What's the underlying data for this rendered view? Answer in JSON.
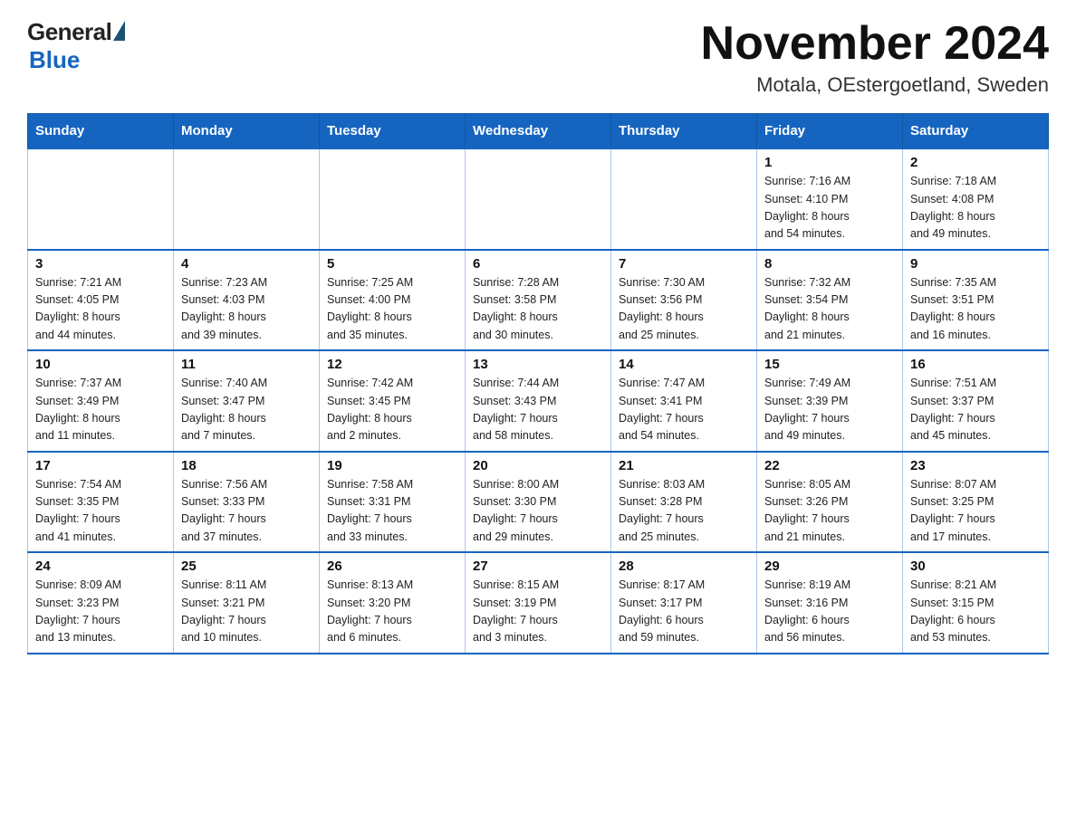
{
  "header": {
    "logo_general": "General",
    "logo_blue": "Blue",
    "month_title": "November 2024",
    "location": "Motala, OEstergoetland, Sweden"
  },
  "calendar": {
    "days_of_week": [
      "Sunday",
      "Monday",
      "Tuesday",
      "Wednesday",
      "Thursday",
      "Friday",
      "Saturday"
    ],
    "weeks": [
      [
        {
          "day": "",
          "info": ""
        },
        {
          "day": "",
          "info": ""
        },
        {
          "day": "",
          "info": ""
        },
        {
          "day": "",
          "info": ""
        },
        {
          "day": "",
          "info": ""
        },
        {
          "day": "1",
          "info": "Sunrise: 7:16 AM\nSunset: 4:10 PM\nDaylight: 8 hours\nand 54 minutes."
        },
        {
          "day": "2",
          "info": "Sunrise: 7:18 AM\nSunset: 4:08 PM\nDaylight: 8 hours\nand 49 minutes."
        }
      ],
      [
        {
          "day": "3",
          "info": "Sunrise: 7:21 AM\nSunset: 4:05 PM\nDaylight: 8 hours\nand 44 minutes."
        },
        {
          "day": "4",
          "info": "Sunrise: 7:23 AM\nSunset: 4:03 PM\nDaylight: 8 hours\nand 39 minutes."
        },
        {
          "day": "5",
          "info": "Sunrise: 7:25 AM\nSunset: 4:00 PM\nDaylight: 8 hours\nand 35 minutes."
        },
        {
          "day": "6",
          "info": "Sunrise: 7:28 AM\nSunset: 3:58 PM\nDaylight: 8 hours\nand 30 minutes."
        },
        {
          "day": "7",
          "info": "Sunrise: 7:30 AM\nSunset: 3:56 PM\nDaylight: 8 hours\nand 25 minutes."
        },
        {
          "day": "8",
          "info": "Sunrise: 7:32 AM\nSunset: 3:54 PM\nDaylight: 8 hours\nand 21 minutes."
        },
        {
          "day": "9",
          "info": "Sunrise: 7:35 AM\nSunset: 3:51 PM\nDaylight: 8 hours\nand 16 minutes."
        }
      ],
      [
        {
          "day": "10",
          "info": "Sunrise: 7:37 AM\nSunset: 3:49 PM\nDaylight: 8 hours\nand 11 minutes."
        },
        {
          "day": "11",
          "info": "Sunrise: 7:40 AM\nSunset: 3:47 PM\nDaylight: 8 hours\nand 7 minutes."
        },
        {
          "day": "12",
          "info": "Sunrise: 7:42 AM\nSunset: 3:45 PM\nDaylight: 8 hours\nand 2 minutes."
        },
        {
          "day": "13",
          "info": "Sunrise: 7:44 AM\nSunset: 3:43 PM\nDaylight: 7 hours\nand 58 minutes."
        },
        {
          "day": "14",
          "info": "Sunrise: 7:47 AM\nSunset: 3:41 PM\nDaylight: 7 hours\nand 54 minutes."
        },
        {
          "day": "15",
          "info": "Sunrise: 7:49 AM\nSunset: 3:39 PM\nDaylight: 7 hours\nand 49 minutes."
        },
        {
          "day": "16",
          "info": "Sunrise: 7:51 AM\nSunset: 3:37 PM\nDaylight: 7 hours\nand 45 minutes."
        }
      ],
      [
        {
          "day": "17",
          "info": "Sunrise: 7:54 AM\nSunset: 3:35 PM\nDaylight: 7 hours\nand 41 minutes."
        },
        {
          "day": "18",
          "info": "Sunrise: 7:56 AM\nSunset: 3:33 PM\nDaylight: 7 hours\nand 37 minutes."
        },
        {
          "day": "19",
          "info": "Sunrise: 7:58 AM\nSunset: 3:31 PM\nDaylight: 7 hours\nand 33 minutes."
        },
        {
          "day": "20",
          "info": "Sunrise: 8:00 AM\nSunset: 3:30 PM\nDaylight: 7 hours\nand 29 minutes."
        },
        {
          "day": "21",
          "info": "Sunrise: 8:03 AM\nSunset: 3:28 PM\nDaylight: 7 hours\nand 25 minutes."
        },
        {
          "day": "22",
          "info": "Sunrise: 8:05 AM\nSunset: 3:26 PM\nDaylight: 7 hours\nand 21 minutes."
        },
        {
          "day": "23",
          "info": "Sunrise: 8:07 AM\nSunset: 3:25 PM\nDaylight: 7 hours\nand 17 minutes."
        }
      ],
      [
        {
          "day": "24",
          "info": "Sunrise: 8:09 AM\nSunset: 3:23 PM\nDaylight: 7 hours\nand 13 minutes."
        },
        {
          "day": "25",
          "info": "Sunrise: 8:11 AM\nSunset: 3:21 PM\nDaylight: 7 hours\nand 10 minutes."
        },
        {
          "day": "26",
          "info": "Sunrise: 8:13 AM\nSunset: 3:20 PM\nDaylight: 7 hours\nand 6 minutes."
        },
        {
          "day": "27",
          "info": "Sunrise: 8:15 AM\nSunset: 3:19 PM\nDaylight: 7 hours\nand 3 minutes."
        },
        {
          "day": "28",
          "info": "Sunrise: 8:17 AM\nSunset: 3:17 PM\nDaylight: 6 hours\nand 59 minutes."
        },
        {
          "day": "29",
          "info": "Sunrise: 8:19 AM\nSunset: 3:16 PM\nDaylight: 6 hours\nand 56 minutes."
        },
        {
          "day": "30",
          "info": "Sunrise: 8:21 AM\nSunset: 3:15 PM\nDaylight: 6 hours\nand 53 minutes."
        }
      ]
    ]
  }
}
